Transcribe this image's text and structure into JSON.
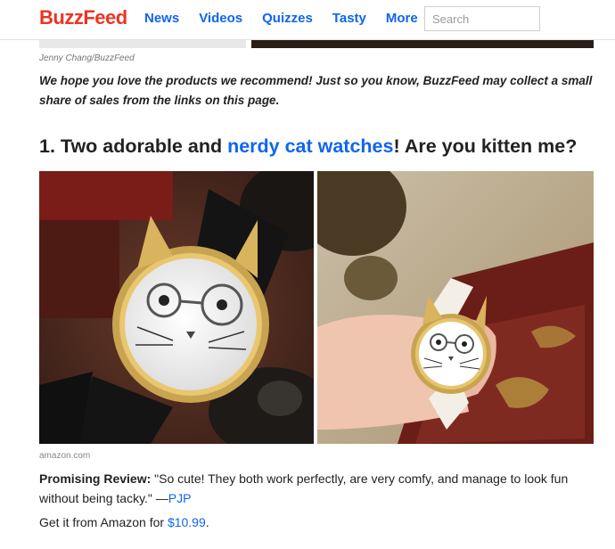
{
  "header": {
    "logo": "BuzzFeed",
    "nav": [
      "News",
      "Videos",
      "Quizzes",
      "Tasty"
    ],
    "more_label": "More",
    "search_placeholder": "Search"
  },
  "article": {
    "photo_credit": "Jenny Chang/BuzzFeed",
    "disclaimer": "We hope you love the products we recommend! Just so you know, BuzzFeed may collect a small share of sales from the links on this page.",
    "item": {
      "headline_prefix": "1. Two adorable and ",
      "headline_link": "nerdy cat watches",
      "headline_suffix": "! Are you kitten me?",
      "image_credit": "amazon.com",
      "review_label": "Promising Review:",
      "review_text": " \"So cute! They both work perfectly, are very comfy, and manage to look fun without being tacky.\" —",
      "review_author": "PJP",
      "get_prefix": "Get it from Amazon for ",
      "price": "$10.99",
      "get_suffix": "."
    }
  },
  "colors": {
    "brand": "#ee3322",
    "link": "#0f65ef"
  },
  "icons": {
    "more_chevron": "chevron-down-icon"
  }
}
